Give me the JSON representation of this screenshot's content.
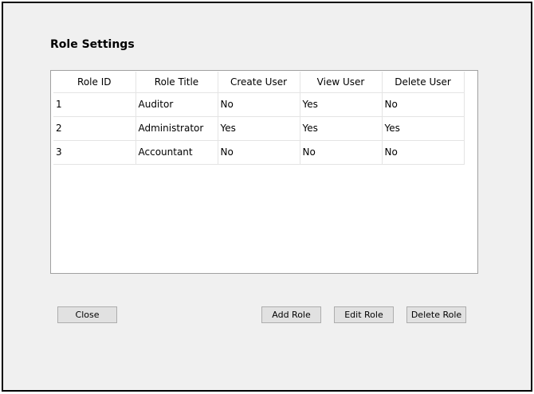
{
  "window": {
    "title": "Role Settings"
  },
  "grid": {
    "columns": [
      "Role ID",
      "Role Title",
      "Create User",
      "View User",
      "Delete User"
    ],
    "rows": [
      [
        "1",
        "Auditor",
        "No",
        "Yes",
        "No"
      ],
      [
        "2",
        "Administrator",
        "Yes",
        "Yes",
        "Yes"
      ],
      [
        "3",
        "Accountant",
        "No",
        "No",
        "No"
      ]
    ]
  },
  "buttons": {
    "close": "Close",
    "add_role": "Add Role",
    "edit_role": "Edit Role",
    "delete_role": "Delete Role"
  }
}
